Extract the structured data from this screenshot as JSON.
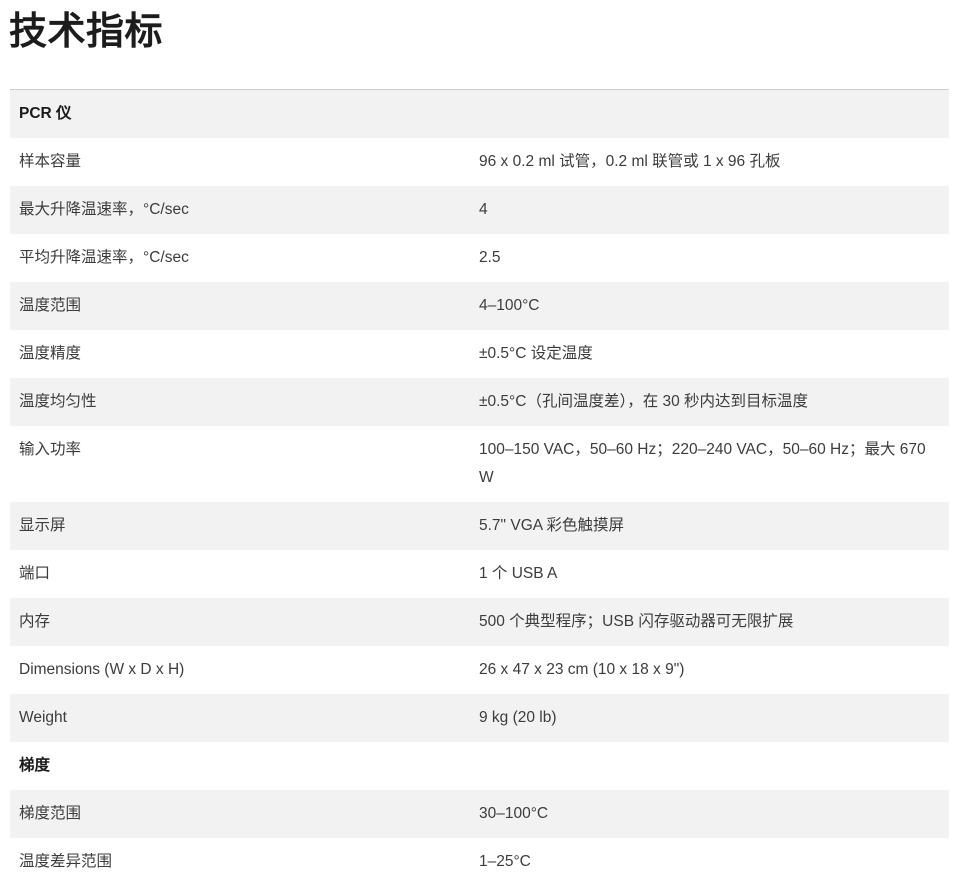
{
  "page_title": "技术指标",
  "sections": [
    {
      "heading": "PCR 仪",
      "rows": [
        {
          "label": "样本容量",
          "value": "96 x 0.2 ml 试管，0.2 ml 联管或 1 x 96 孔板"
        },
        {
          "label": "最大升降温速率，°C/sec",
          "value": "4"
        },
        {
          "label": "平均升降温速率，°C/sec",
          "value": "2.5"
        },
        {
          "label": "温度范围",
          "value": "4–100°C"
        },
        {
          "label": "温度精度",
          "value": "±0.5°C 设定温度"
        },
        {
          "label": "温度均匀性",
          "value": "±0.5°C（孔间温度差），在 30 秒内达到目标温度"
        },
        {
          "label": "输入功率",
          "value": "100–150 VAC，50–60 Hz；220–240 VAC，50–60 Hz；最大 670 W"
        },
        {
          "label": "显示屏",
          "value": "5.7\" VGA 彩色触摸屏"
        },
        {
          "label": "端口",
          "value": "1 个 USB A"
        },
        {
          "label": "内存",
          "value": "500 个典型程序；USB 闪存驱动器可无限扩展"
        },
        {
          "label": "Dimensions (W x D x H)",
          "value": "26 x 47 x 23 cm (10 x 18 x 9\")"
        },
        {
          "label": "Weight",
          "value": "9 kg (20 lb)"
        }
      ]
    },
    {
      "heading": "梯度",
      "rows": [
        {
          "label": "梯度范围",
          "value": "30–100°C"
        },
        {
          "label": "温度差异范围",
          "value": "1–25°C"
        }
      ]
    }
  ]
}
